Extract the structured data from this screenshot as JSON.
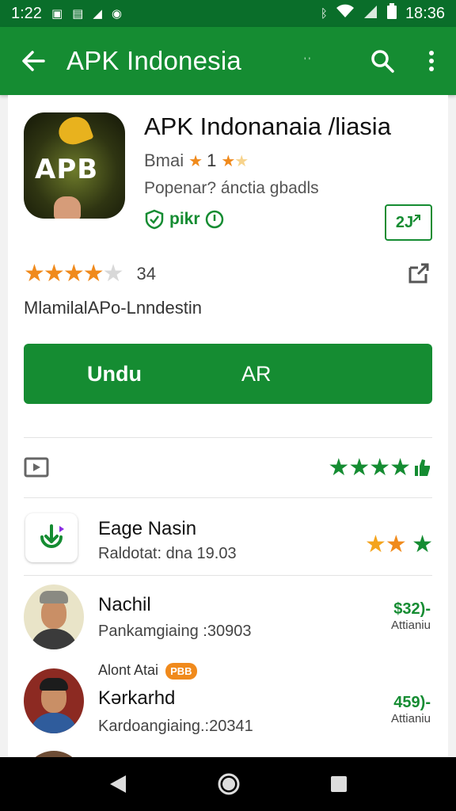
{
  "status_bar": {
    "time": "1:22",
    "right_time": "18:36",
    "left_icons": [
      "notification-icon",
      "message-icon",
      "send-icon",
      "location-icon"
    ],
    "right_icons": [
      "bluetooth-icon",
      "wifi-icon",
      "signal-icon",
      "battery-icon"
    ]
  },
  "app_bar": {
    "title": "APK Indonesia",
    "extra": "' '",
    "background": "#158c32"
  },
  "app": {
    "name": "APK Indonanaia /liasia",
    "developer": "Bmai",
    "developer_rating_text": "1",
    "subtitle": "Popenar? ánctia gbadls",
    "badge_label": "pikr",
    "share_box_label": "2J",
    "icon_text": "APB",
    "rating": 4.5,
    "rating_count": "34",
    "tagline": "MlamilalAPo-Lnndestin"
  },
  "install": {
    "label": "Undu",
    "secondary": "AR"
  },
  "media_row": {
    "left_icon": "video-icon",
    "stars": 4
  },
  "list": [
    {
      "title": "Eage Nasin",
      "meta": "Raldotat: dna  19.03",
      "stars_orange": 2,
      "stars_green": 1
    },
    {
      "title": "Nachil",
      "meta": "Pankamgiaing :30903",
      "price": "$32)-",
      "price_sub": "Attianiu"
    },
    {
      "title": "Kərkarhd",
      "above_label": "Alont Atai",
      "above_badge": "PBB",
      "meta": "Kardoangiaing.:20341",
      "price": "459)-",
      "price_sub": "Attianiu"
    }
  ],
  "colors": {
    "accent": "#158c32",
    "status_bar": "#0a6e2a",
    "star": "#f08a1c"
  }
}
